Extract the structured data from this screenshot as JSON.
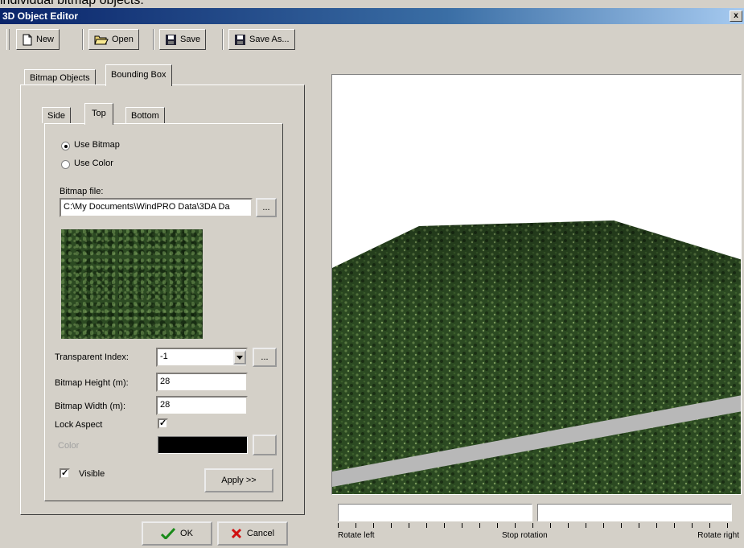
{
  "caption": "individual bitmap objects.",
  "window": {
    "title": "3D Object Editor",
    "close_glyph": "x"
  },
  "toolbar": {
    "new_label": "New",
    "open_label": "Open",
    "save_label": "Save",
    "save_as_label": "Save As..."
  },
  "main_tabs": [
    {
      "label": "Bitmap Objects",
      "active": false
    },
    {
      "label": "Bounding Box",
      "active": true
    }
  ],
  "sub_tabs": [
    {
      "label": "Side",
      "active": false
    },
    {
      "label": "Top",
      "active": true
    },
    {
      "label": "Bottom",
      "active": false
    }
  ],
  "source": {
    "use_bitmap_label": "Use Bitmap",
    "use_color_label": "Use Color",
    "selected": "Use Bitmap"
  },
  "bitmap_file": {
    "label": "Bitmap file:",
    "value": "C:\\My Documents\\WindPRO Data\\3DA Da",
    "browse_label": "..."
  },
  "form": {
    "transparent_index_label": "Transparent Index:",
    "transparent_index_value": "-1",
    "transparent_browse_label": "...",
    "bitmap_height_label": "Bitmap Height (m):",
    "bitmap_height_value": "28",
    "bitmap_width_label": "Bitmap Width (m):",
    "bitmap_width_value": "28",
    "lock_aspect_label": "Lock Aspect",
    "lock_aspect_checked": true,
    "color_label": "Color",
    "color_value": "#000000",
    "color_browse_label": "...",
    "visible_label": "Visible",
    "visible_checked": true,
    "apply_label": "Apply >>"
  },
  "dialog_buttons": {
    "ok_label": "OK",
    "cancel_label": "Cancel"
  },
  "rotation": {
    "left_label": "Rotate left",
    "stop_label": "Stop rotation",
    "right_label": "Rotate right"
  },
  "colors": {
    "title_bar": "#0a246a",
    "dialog_bg": "#d4d0c8",
    "viewport_bg": "#ffffff",
    "foliage": "#2c4a22",
    "ground_strip": "#b8b8b8"
  },
  "icons": {
    "new": "new-document-icon",
    "open": "open-folder-icon",
    "save": "floppy-disk-icon",
    "save_as": "floppy-disk-icon",
    "ok": "checkmark-icon",
    "cancel": "red-x-icon",
    "dropdown": "chevron-down-icon"
  }
}
